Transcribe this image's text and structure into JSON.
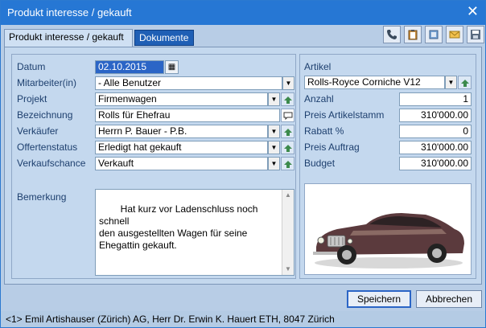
{
  "window": {
    "title": "Produkt interesse / gekauft"
  },
  "tabs": [
    {
      "label": "Produkt interesse / gekauft",
      "active": true
    },
    {
      "label": "Dokumente",
      "active": false
    }
  ],
  "toolbar": {
    "icons": [
      "phone-icon",
      "clipboard-icon",
      "document-icon",
      "mail-icon",
      "save-disk-icon"
    ]
  },
  "form": {
    "datum": {
      "label": "Datum",
      "value": "02.10.2015"
    },
    "mitarbeiter": {
      "label": "Mitarbeiter(in)",
      "value": "- Alle Benutzer"
    },
    "projekt": {
      "label": "Projekt",
      "value": "Firmenwagen"
    },
    "bezeichnung": {
      "label": "Bezeichnung",
      "value": "Rolls für Ehefrau"
    },
    "verkaeufer": {
      "label": "Verkäufer",
      "value": "Herrn P. Bauer - P.B."
    },
    "offertenstatus": {
      "label": "Offertenstatus",
      "value": "Erledigt hat gekauft"
    },
    "verkaufschance": {
      "label": "Verkaufschance",
      "value": "Verkauft"
    },
    "bemerkung": {
      "label": "Bemerkung",
      "value": "Hat kurz vor Ladenschluss noch schnell\nden ausgestellten Wagen für seine\nEhegattin gekauft."
    }
  },
  "article": {
    "label": "Artikel",
    "value": "Rolls-Royce Corniche V12",
    "anzahl": {
      "label": "Anzahl",
      "value": "1"
    },
    "preis_artikelstamm": {
      "label": "Preis Artikelstamm",
      "value": "310'000.00"
    },
    "rabatt": {
      "label": "Rabatt %",
      "value": "0"
    },
    "preis_auftrag": {
      "label": "Preis Auftrag",
      "value": "310'000.00"
    },
    "budget": {
      "label": "Budget",
      "value": "310'000.00"
    }
  },
  "buttons": {
    "save": "Speichern",
    "cancel": "Abbrechen"
  },
  "status": "<1> Emil Artishauser (Zürich) AG, Herr Dr. Erwin K. Hauert ETH, 8047 Zürich",
  "colors": {
    "titlebar": "#2677d4",
    "active_tab_inactive": "#1f5fb5",
    "selection": "#2b65c6"
  }
}
